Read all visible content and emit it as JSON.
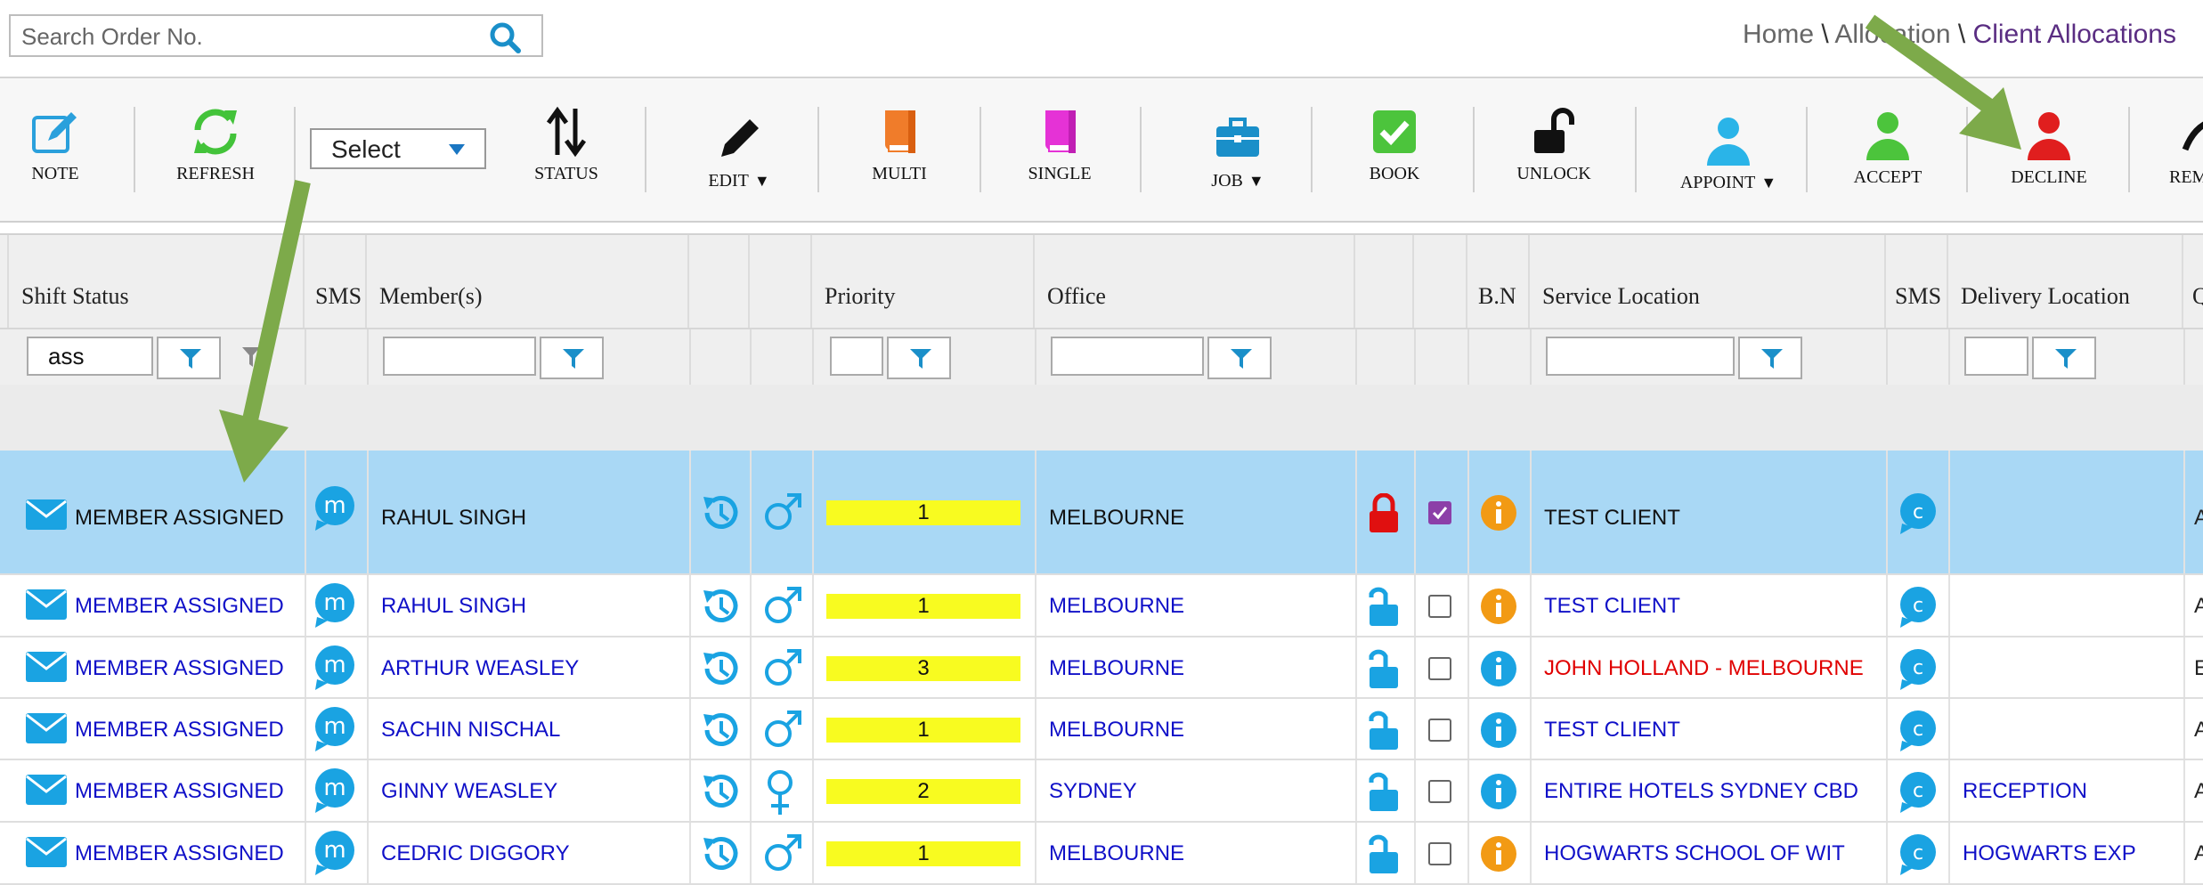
{
  "search": {
    "placeholder": "Search Order No."
  },
  "breadcrumb": {
    "home": "Home",
    "mid": "Allocation",
    "current": "Client Allocations",
    "sep": "\\"
  },
  "toolbar": {
    "note": "NOTE",
    "refresh": "REFRESH",
    "select": "Select",
    "status": "STATUS",
    "edit": "EDIT",
    "multi": "MULTI",
    "single": "SINGLE",
    "job": "JOB",
    "book": "BOOK",
    "unlock": "UNLOCK",
    "appoint": "APPOINT",
    "accept": "ACCEPT",
    "decline": "DECLINE",
    "rem": "REM"
  },
  "columns": {
    "shift_status": "Shift Status",
    "sms": "SMS",
    "members": "Member(s)",
    "priority": "Priority",
    "office": "Office",
    "bn": "B.N",
    "service_location": "Service Location",
    "sms2": "SMS",
    "delivery_location": "Delivery Location",
    "q": "Q"
  },
  "filters": {
    "shift_status": "ass"
  },
  "colors": {
    "accent": "#1a9bd8",
    "link": "#1010c8",
    "alert": "#e00000",
    "priority": "#f8fb20",
    "selected": "#a9d8f5",
    "arrow": "#7daa4a"
  },
  "rows": [
    {
      "status": "MEMBER ASSIGNED",
      "member": "RAHUL SINGH",
      "gender": "male",
      "priority": "1",
      "office": "MELBOURNE",
      "lock": "locked",
      "checked": true,
      "info": "orange",
      "service": "TEST CLIENT",
      "service_red": false,
      "delivery": "",
      "q": "A",
      "selected": true
    },
    {
      "status": "MEMBER ASSIGNED",
      "member": "RAHUL SINGH",
      "gender": "male",
      "priority": "1",
      "office": "MELBOURNE",
      "lock": "unlocked",
      "checked": false,
      "info": "orange",
      "service": "TEST CLIENT",
      "service_red": false,
      "delivery": "",
      "q": "A",
      "selected": false
    },
    {
      "status": "MEMBER ASSIGNED",
      "member": "ARTHUR WEASLEY",
      "gender": "male",
      "priority": "3",
      "office": "MELBOURNE",
      "lock": "unlocked",
      "checked": false,
      "info": "blue",
      "service": "JOHN HOLLAND - MELBOURNE",
      "service_red": true,
      "delivery": "",
      "q": "E",
      "selected": false
    },
    {
      "status": "MEMBER ASSIGNED",
      "member": "SACHIN NISCHAL",
      "gender": "male",
      "priority": "1",
      "office": "MELBOURNE",
      "lock": "unlocked",
      "checked": false,
      "info": "blue",
      "service": "TEST CLIENT",
      "service_red": false,
      "delivery": "",
      "q": "A",
      "selected": false
    },
    {
      "status": "MEMBER ASSIGNED",
      "member": "GINNY WEASLEY",
      "gender": "female",
      "priority": "2",
      "office": "SYDNEY",
      "lock": "unlocked",
      "checked": false,
      "info": "blue",
      "service": "ENTIRE HOTELS SYDNEY CBD",
      "service_red": false,
      "delivery": "RECEPTION",
      "q": "A",
      "selected": false
    },
    {
      "status": "MEMBER ASSIGNED",
      "member": "CEDRIC DIGGORY",
      "gender": "male",
      "priority": "1",
      "office": "MELBOURNE",
      "lock": "unlocked",
      "checked": false,
      "info": "orange",
      "service": "HOGWARTS SCHOOL OF WIT",
      "service_red": false,
      "delivery": "HOGWARTS EXP",
      "q": "A",
      "selected": false
    }
  ]
}
